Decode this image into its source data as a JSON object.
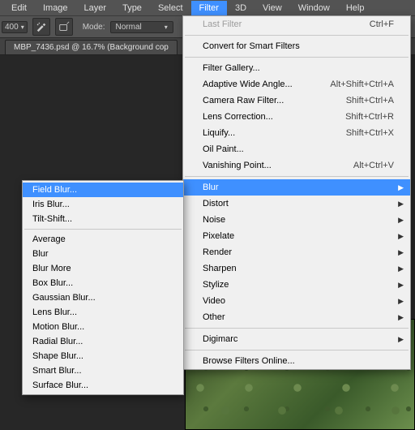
{
  "menubar": {
    "items": [
      {
        "label": "Edit"
      },
      {
        "label": "Image"
      },
      {
        "label": "Layer"
      },
      {
        "label": "Type"
      },
      {
        "label": "Select"
      },
      {
        "label": "Filter",
        "open": true
      },
      {
        "label": "3D"
      },
      {
        "label": "View"
      },
      {
        "label": "Window"
      },
      {
        "label": "Help"
      }
    ]
  },
  "toolbar": {
    "iso": "400",
    "mode_label": "Mode:",
    "mode_value": "Normal"
  },
  "doctab": "MBP_7436.psd @ 16.7% (Background cop",
  "filter_menu": [
    {
      "label": "Last Filter",
      "shortcut": "Ctrl+F",
      "disabled": true
    },
    {
      "sep": true
    },
    {
      "label": "Convert for Smart Filters"
    },
    {
      "sep": true
    },
    {
      "label": "Filter Gallery..."
    },
    {
      "label": "Adaptive Wide Angle...",
      "shortcut": "Alt+Shift+Ctrl+A"
    },
    {
      "label": "Camera Raw Filter...",
      "shortcut": "Shift+Ctrl+A"
    },
    {
      "label": "Lens Correction...",
      "shortcut": "Shift+Ctrl+R"
    },
    {
      "label": "Liquify...",
      "shortcut": "Shift+Ctrl+X"
    },
    {
      "label": "Oil Paint..."
    },
    {
      "label": "Vanishing Point...",
      "shortcut": "Alt+Ctrl+V"
    },
    {
      "sep": true
    },
    {
      "label": "Blur",
      "submenu": true,
      "hl": true
    },
    {
      "label": "Distort",
      "submenu": true
    },
    {
      "label": "Noise",
      "submenu": true
    },
    {
      "label": "Pixelate",
      "submenu": true
    },
    {
      "label": "Render",
      "submenu": true
    },
    {
      "label": "Sharpen",
      "submenu": true
    },
    {
      "label": "Stylize",
      "submenu": true
    },
    {
      "label": "Video",
      "submenu": true
    },
    {
      "label": "Other",
      "submenu": true
    },
    {
      "sep": true
    },
    {
      "label": "Digimarc",
      "submenu": true
    },
    {
      "sep": true
    },
    {
      "label": "Browse Filters Online..."
    }
  ],
  "blur_submenu": [
    {
      "label": "Field Blur...",
      "hl": true
    },
    {
      "label": "Iris Blur..."
    },
    {
      "label": "Tilt-Shift..."
    },
    {
      "sep": true
    },
    {
      "label": "Average"
    },
    {
      "label": "Blur"
    },
    {
      "label": "Blur More"
    },
    {
      "label": "Box Blur..."
    },
    {
      "label": "Gaussian Blur..."
    },
    {
      "label": "Lens Blur..."
    },
    {
      "label": "Motion Blur..."
    },
    {
      "label": "Radial Blur..."
    },
    {
      "label": "Shape Blur..."
    },
    {
      "label": "Smart Blur..."
    },
    {
      "label": "Surface Blur..."
    }
  ]
}
